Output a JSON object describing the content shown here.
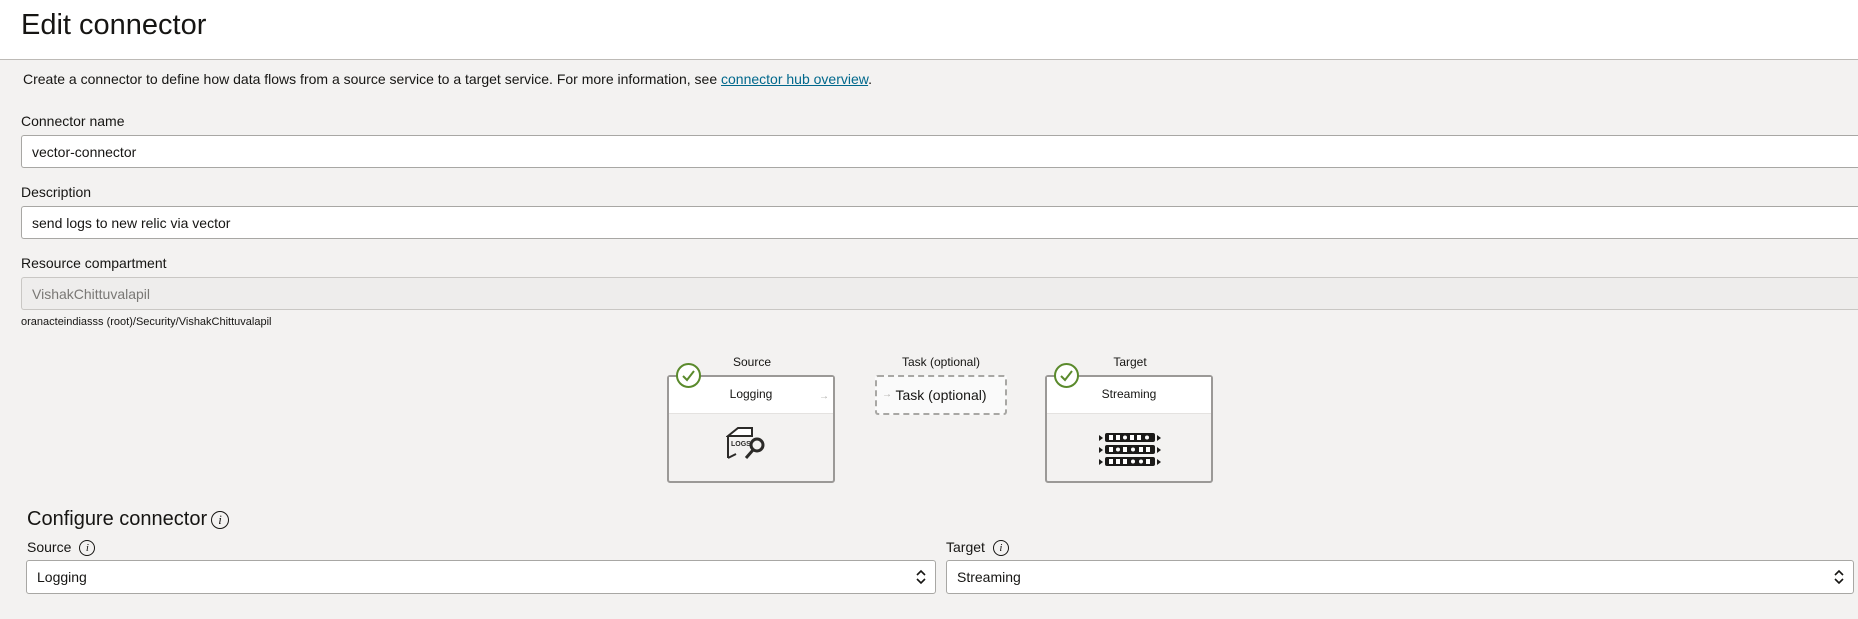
{
  "page": {
    "title": "Edit connector"
  },
  "intro": {
    "text": "Create a connector to define how data flows from a source service to a target service. For more information, see ",
    "link": "connector hub overview",
    "suffix": "."
  },
  "form": {
    "name_label": "Connector name",
    "name_value": "vector-connector",
    "description_label": "Description",
    "description_value": "send logs to new relic via vector",
    "compartment_label": "Resource compartment",
    "compartment_value": "VishakChittuvalapil",
    "compartment_path": "oranacteindiasss (root)/Security/VishakChittuvalapil"
  },
  "flow": {
    "source": {
      "heading": "Source",
      "name": "Logging",
      "icon": "logs-icon",
      "status": "complete"
    },
    "task": {
      "heading": "Task (optional)",
      "name": "Task (optional)"
    },
    "target": {
      "heading": "Target",
      "name": "Streaming",
      "icon": "streaming-icon",
      "status": "complete"
    },
    "logs_icon_text": "LOGS"
  },
  "configure": {
    "title": "Configure connector",
    "source_label": "Source",
    "source_value": "Logging",
    "target_label": "Target",
    "target_value": "Streaming"
  },
  "colors": {
    "link": "#00688c",
    "check": "#5a8a2c",
    "background": "#f3f2f1"
  }
}
